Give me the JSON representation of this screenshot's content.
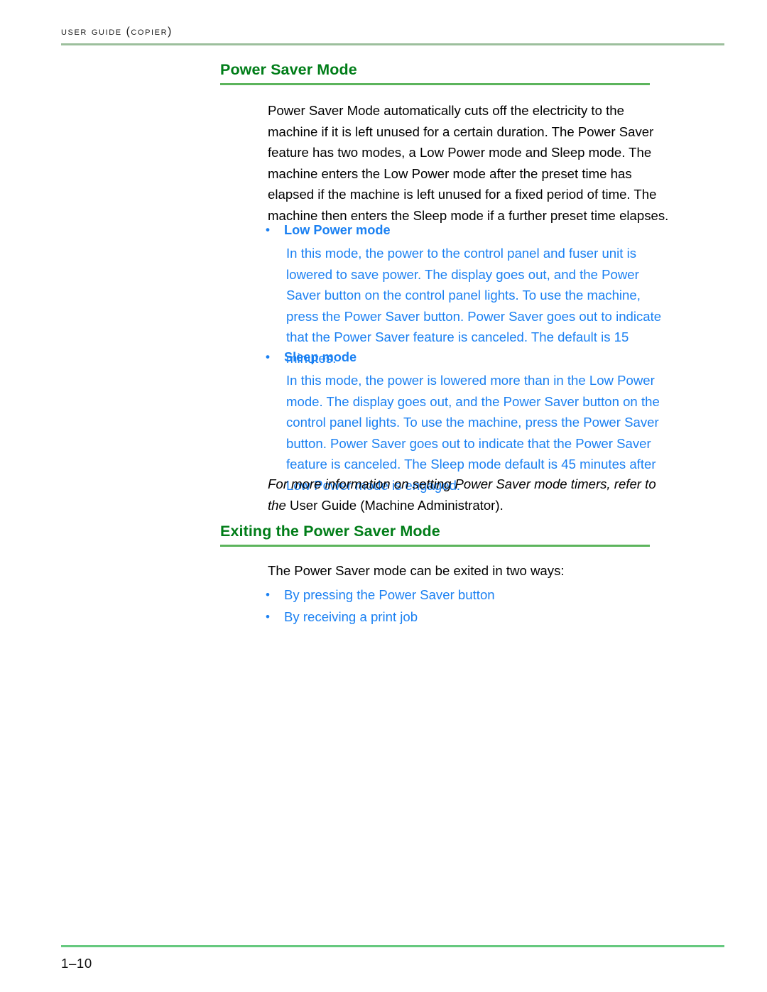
{
  "header": {
    "running_title": "User Guide (Copier)",
    "rule_color": "#9cbf9c"
  },
  "headings": {
    "power_saver_mode": "Power Saver Mode",
    "exiting_power_saver_mode": "Exiting the Power Saver Mode",
    "color": "#007d18",
    "rule_color": "#5cb45c"
  },
  "content": {
    "intro_paragraph": "Power Saver Mode automatically cuts off the electricity to the machine if it is left unused for a certain duration. The Power Saver feature has two modes, a Low Power mode and Sleep mode. The machine enters the Low Power mode after the preset time has elapsed if the machine is left unused for a fixed period of time. The machine then enters the Sleep mode if a further preset time elapses.",
    "modes": [
      {
        "bullet": "•",
        "title": "Low Power mode",
        "body": "In this mode, the power to the control panel and fuser unit is lowered to save power. The display goes out, and the Power Saver button on the control panel lights. To use the machine, press the Power Saver button. Power Saver goes out to indicate that the Power Saver feature is canceled. The default is 15 minutes."
      },
      {
        "bullet": "•",
        "title": "Sleep mode",
        "body": "In this mode, the power is lowered more than in the Low Power mode. The display goes out, and the Power Saver button on the control panel lights. To use the machine, press the Power Saver button. Power Saver goes out to indicate that the Power Saver feature is canceled. The Sleep mode default is 45 minutes after Low Power mode is engaged."
      }
    ],
    "note": {
      "italic_part": "For more information on setting Power Saver mode timers, refer to the",
      "roman_part": " User Guide (Machine Administrator)."
    },
    "exiting_intro": "The Power Saver mode can be exited in two ways:",
    "exiting_list": [
      {
        "bullet": "•",
        "label": "By pressing the Power Saver button"
      },
      {
        "bullet": "•",
        "label": "By receiving a print job"
      }
    ],
    "blue_color": "#1a80f2"
  },
  "footer": {
    "page_number": "1–10",
    "rule_color": "#66c97f"
  }
}
